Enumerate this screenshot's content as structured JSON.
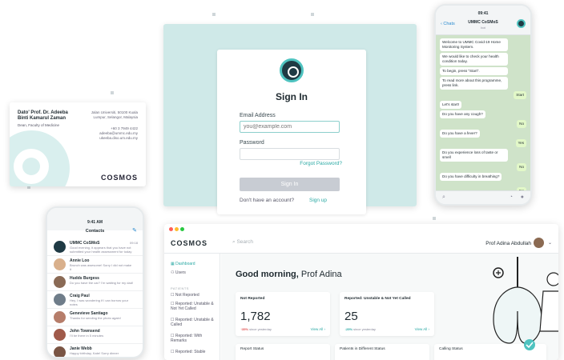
{
  "signin": {
    "title": "Sign In",
    "email_label": "Email Address",
    "email_placeholder": "you@example.com",
    "password_label": "Password",
    "forgot": "Forgot Password?",
    "button": "Sign In",
    "no_account": "Don't have an account?",
    "signup": "Sign up"
  },
  "bcard": {
    "name_line1": "Dato' Prof. Dr. Adeeba",
    "name_line2": "Binti Kamarul Zaman",
    "role": "Dean, Faculty of Medicine",
    "addr1": "Jalan Universiti, 50100 Kuala",
    "addr2": "Lumpur, Selangor, Malaysia",
    "phone": "+60 3 7949 4422",
    "email": "adeeba@ummc.edu.my",
    "web": "ukeeba.diso.um.edu.my",
    "brand": "COSMOS"
  },
  "chat": {
    "time": "09:41",
    "back": "Chats",
    "title": "UMMC CoSMoS",
    "subtitle": "bot",
    "messages": [
      {
        "text": "Welcome to UMMC Covid-19 Home Monitoring System.",
        "out": false
      },
      {
        "text": "We would like to check your health condition today.",
        "out": false
      },
      {
        "text": "To begin, press \"Start\".",
        "out": false
      },
      {
        "text": "To read more about this programme, press link.",
        "out": false
      },
      {
        "text": "Start",
        "out": true
      },
      {
        "text": "Let's start!",
        "out": false
      },
      {
        "text": "Do you have any cough?",
        "out": false
      },
      {
        "text": "No",
        "out": true
      },
      {
        "text": "Do you have a fever?",
        "out": false
      },
      {
        "text": "Yes",
        "out": true
      },
      {
        "text": "Do you experience loss of taste or smell",
        "out": false
      },
      {
        "text": "No",
        "out": true
      },
      {
        "text": "Do you have difficulty in breathing?",
        "out": false
      },
      {
        "text": "No",
        "out": true
      }
    ]
  },
  "contacts": {
    "time": "9:41 AM",
    "title": "Contacts",
    "items": [
      {
        "name": "UMMC CoSMoS",
        "msg": "Good evening, it appears that you have not submitted your health assessment for today",
        "time": "09:18",
        "color": "#1f3a44"
      },
      {
        "name": "Annie Loo",
        "msg": "Brunch was awesome! Sorry I did not make it",
        "time": "",
        "color": "#d9b08c"
      },
      {
        "name": "Hudds Burgess",
        "msg": "Do you have the car? I'm waiting for my dad!",
        "time": "",
        "color": "#8a6a55"
      },
      {
        "name": "Craig Paul",
        "msg": "Hey, I was wondering if I can borrow your notes",
        "time": "",
        "color": "#6f7d8a"
      },
      {
        "name": "Genevieve Santiago",
        "msg": "Thanks for sending the photo again!",
        "time": "",
        "color": "#b67d6a"
      },
      {
        "name": "John Townsend",
        "msg": "I'll be there in 5 minutes",
        "time": "",
        "color": "#a05a4a"
      },
      {
        "name": "Janie Webb",
        "msg": "Happy birthday, Kate! Sorry dinner",
        "time": "",
        "color": "#7a5544"
      }
    ]
  },
  "dashboard": {
    "brand": "COSMOS",
    "search": "Search",
    "user": "Prof Adina Abdullah",
    "nav": {
      "dashboard": "Dashboard",
      "users": "Users",
      "patients_section": "PATIENTS",
      "not_reported": "Not Reported",
      "unstable_not_called": "Reported: Unstable & Not Yet Called",
      "unstable_called": "Reported: Unstable & Called",
      "with_remarks": "Reported: With Remarks",
      "stable": "Reported: Stable"
    },
    "greeting_prefix": "Good morning,",
    "greeting_name": "Prof Adina",
    "kpi1": {
      "title": "Not Reported",
      "value": "1,782",
      "delta": "35%",
      "delta_text": "since yesterday",
      "link": "View All"
    },
    "kpi2": {
      "title": "Reported: Unstable & Not Yet Called",
      "value": "25",
      "delta": "25%",
      "delta_text": "since yesterday",
      "link": "View All"
    },
    "lower1": "Report Status",
    "lower2": "Patients in Different Status",
    "lower3": "Calling Status"
  }
}
